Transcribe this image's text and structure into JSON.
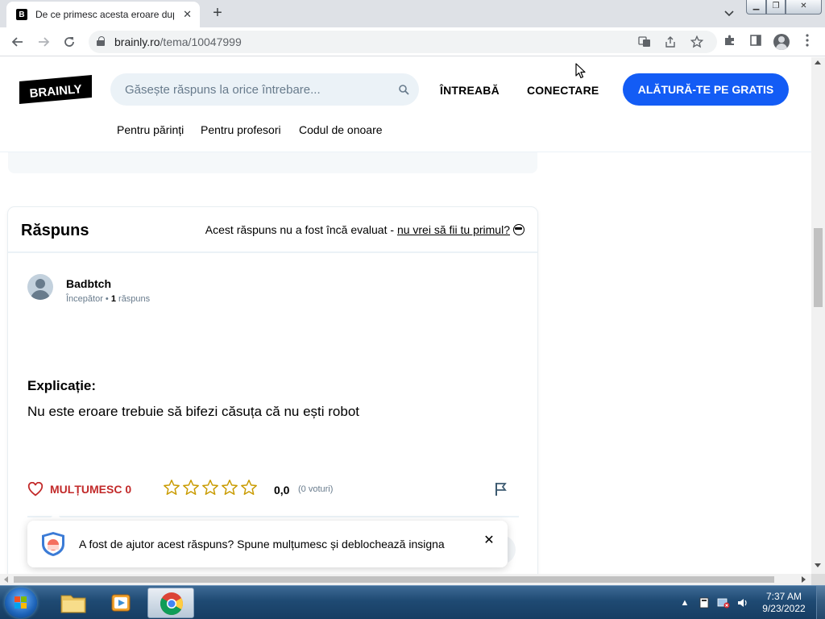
{
  "browser": {
    "tab_title": "De ce primesc acesta eroare dup",
    "favicon_letter": "B",
    "url_host": "brainly.ro",
    "url_path": "/tema/10047999",
    "new_tab_symbol": "+",
    "tab_close_symbol": "✕"
  },
  "header": {
    "logo_text": "BRAINLY",
    "search_placeholder": "Găsește răspuns la orice întrebare...",
    "ask_label": "ÎNTREABĂ",
    "login_label": "CONECTARE",
    "join_label": "ALĂTURĂ-TE PE GRATIS",
    "subnav": [
      "Pentru părinți",
      "Pentru profesori",
      "Codul de onoare"
    ]
  },
  "answer": {
    "section_title": "Răspuns",
    "rating_note": "Acest răspuns nu a fost încă evaluat - ",
    "rating_link": "nu vrei să fii tu primul?",
    "author_name": "Badbtch",
    "author_rank": "Începător",
    "author_answers_count": "1",
    "author_answers_label": "răspuns",
    "explanation_title": "Explicație:",
    "explanation_text": "Nu este eroare trebuie să bifezi căsuța că nu ești robot",
    "thanks_label": "MULȚUMESC",
    "thanks_count": "0",
    "rating_value": "0,0",
    "votes_text": "(0 voturi)",
    "stars_filled": 0,
    "stars_total": 5
  },
  "toast": {
    "text": "A fost de ajutor acest răspuns? Spune mulțumesc și deblochează insigna"
  },
  "taskbar": {
    "time": "7:37 AM",
    "date": "9/23/2022"
  },
  "colors": {
    "brand_blue": "#135cf5",
    "thanks_red": "#c22a2a",
    "star_gold": "#c99b00",
    "search_bg": "#ebf2f7"
  }
}
